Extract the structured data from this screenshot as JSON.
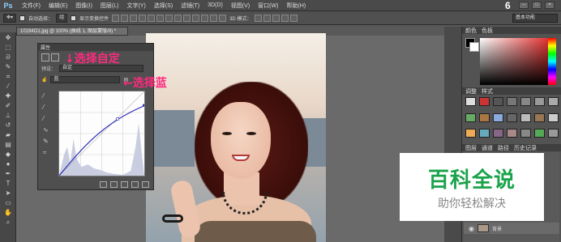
{
  "app": {
    "logo": "Ps",
    "window_number": "6",
    "workspace": "基本功能"
  },
  "menu": [
    "文件(F)",
    "编辑(E)",
    "图像(I)",
    "图层(L)",
    "文字(Y)",
    "选择(S)",
    "滤镜(T)",
    "3D(D)",
    "视图(V)",
    "窗口(W)",
    "帮助(H)"
  ],
  "options": {
    "auto_select_label": "自动选择：",
    "auto_select_value": "组",
    "show_transform_label": "显示变换控件",
    "mode_3d_label": "3D 模式："
  },
  "document": {
    "tab_title": "10194O1.jpg @ 100% (曲线 1, 图层蒙版/8) *"
  },
  "properties_panel": {
    "title": "属性",
    "preset_label": "预设：",
    "preset_value": "自定",
    "channel_value": "蓝"
  },
  "annotations": {
    "select_custom": "↓选择自定",
    "select_blue": "←选择蓝"
  },
  "right_panels": {
    "color_tabs": [
      "颜色",
      "色板"
    ],
    "adjust_tabs": [
      "调整",
      "样式"
    ],
    "layers_tabs": [
      "图层",
      "通道",
      "路径",
      "历史记录"
    ],
    "layer_name": "背景"
  },
  "watermark": {
    "title": "百科全说",
    "subtitle": "助你轻松解决"
  },
  "colors": {
    "annotation": "#ff2a7f",
    "watermark_green": "#1aa34a",
    "curve_line": "#2b2bb5"
  }
}
